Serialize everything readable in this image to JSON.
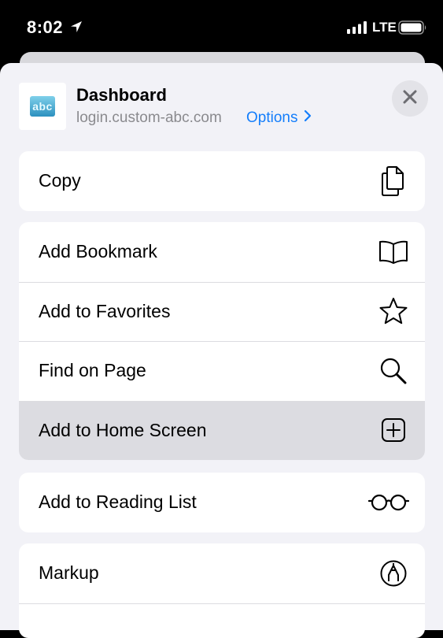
{
  "status_bar": {
    "time": "8:02",
    "network": "LTE"
  },
  "header": {
    "title": "Dashboard",
    "url": "login.custom-abc.com",
    "options_label": "Options",
    "logo_text": "abc"
  },
  "colors": {
    "accent": "#147efb",
    "sheet_background": "#f2f2f7",
    "highlight": "#dcdce1"
  },
  "groups": [
    {
      "items": [
        {
          "label": "Copy",
          "icon": "copy-icon"
        }
      ]
    },
    {
      "items": [
        {
          "label": "Add Bookmark",
          "icon": "book-icon"
        },
        {
          "label": "Add to Favorites",
          "icon": "star-icon"
        },
        {
          "label": "Find on Page",
          "icon": "magnifier-icon"
        },
        {
          "label": "Add to Home Screen",
          "icon": "plus-square-icon",
          "highlighted": true
        }
      ]
    },
    {
      "items": [
        {
          "label": "Add to Reading List",
          "icon": "glasses-icon"
        }
      ]
    },
    {
      "items": [
        {
          "label": "Markup",
          "icon": "markup-pen-icon"
        }
      ]
    }
  ]
}
